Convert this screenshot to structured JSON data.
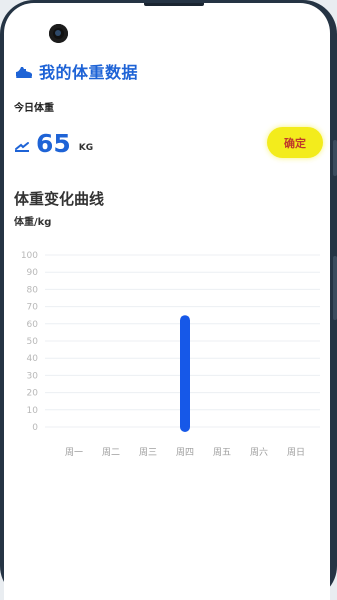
{
  "header": {
    "title": "我的体重数据",
    "icon": "shoe-icon"
  },
  "today": {
    "label": "今日体重",
    "value": "65",
    "unit": "KG",
    "icon": "scale-icon"
  },
  "confirm_label": "确定",
  "chart_section": {
    "title": "体重变化曲线"
  },
  "colors": {
    "accent": "#1e63d6",
    "button": "#f3ec1c",
    "button_text": "#c0392b",
    "bar": "#1658e8"
  },
  "chart_data": {
    "type": "bar",
    "ylabel": "体重/kg",
    "ylim": [
      0,
      100
    ],
    "yticks": [
      0,
      10,
      20,
      30,
      40,
      50,
      60,
      70,
      80,
      90,
      100
    ],
    "categories": [
      "周一",
      "周二",
      "周三",
      "周四",
      "周五",
      "周六",
      "周日"
    ],
    "values": [
      null,
      null,
      null,
      65,
      null,
      null,
      null
    ],
    "grid": true
  }
}
